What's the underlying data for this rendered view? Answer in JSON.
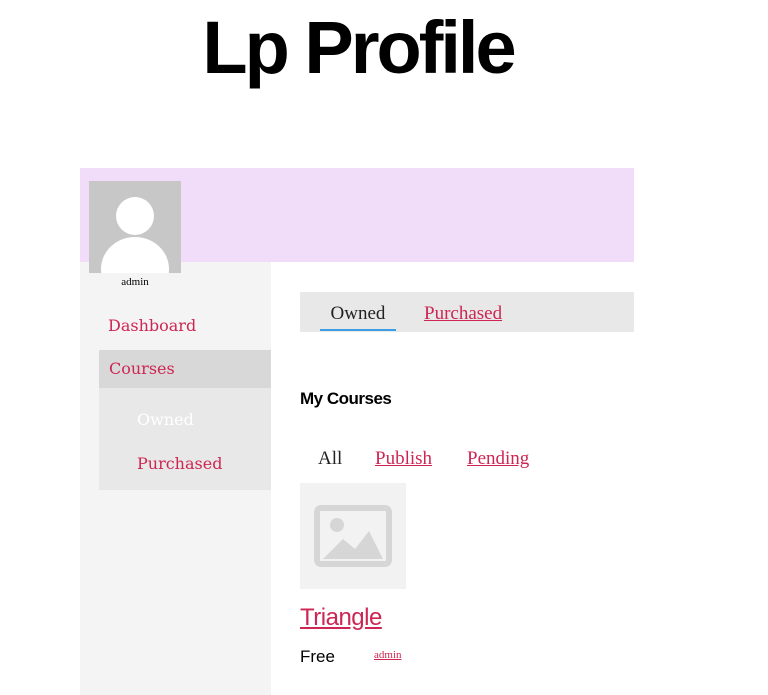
{
  "page": {
    "title": "Lp Profile"
  },
  "profile": {
    "username": "admin"
  },
  "sidebar": {
    "items": [
      {
        "label": "Dashboard"
      },
      {
        "label": "Courses",
        "active": true
      }
    ],
    "subitems": [
      {
        "label": "Owned",
        "active": true
      },
      {
        "label": "Purchased"
      }
    ]
  },
  "tabs": [
    {
      "label": "Owned",
      "active": true
    },
    {
      "label": "Purchased"
    }
  ],
  "section": {
    "title": "My Courses"
  },
  "filters": [
    {
      "label": "All",
      "active": true
    },
    {
      "label": "Publish"
    },
    {
      "label": "Pending"
    }
  ],
  "courses": [
    {
      "title": "Triangle",
      "price": "Free",
      "author": "admin",
      "thumbnail_icon": "image-placeholder-icon"
    }
  ],
  "colors": {
    "accent": "#cd2653",
    "cover": "#f1ddf9",
    "tab_underline": "#3c9ee5"
  }
}
